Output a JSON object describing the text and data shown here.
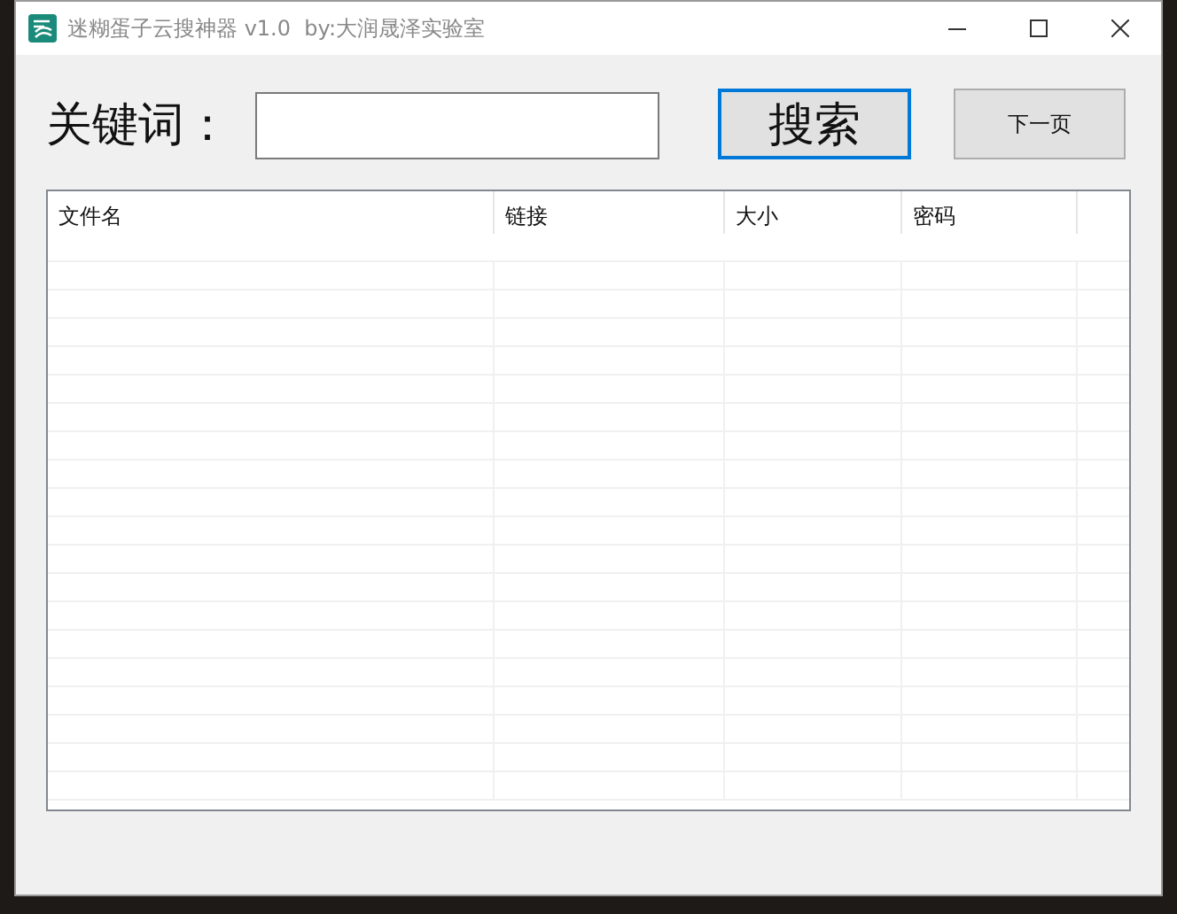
{
  "window": {
    "title": "迷糊蛋子云搜神器 v1.0  by:大润晟泽实验室"
  },
  "search": {
    "label": "关键词："
  },
  "buttons": [
    {
      "kind": "primary",
      "label": "搜索"
    },
    {
      "kind": "normal",
      "label": "下一页"
    }
  ],
  "table": {
    "columns": [
      "文件名",
      "链接",
      "大小",
      "密码"
    ]
  }
}
